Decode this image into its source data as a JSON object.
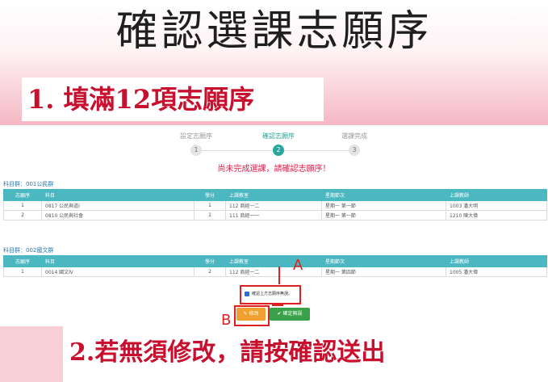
{
  "main_title": "確認選課志願序",
  "step1_text": "1. 填滿12項志願序",
  "step2_text": "2.若無須修改，請按確認送出",
  "wizard": {
    "steps": [
      {
        "label": "設定志願序",
        "num": "1"
      },
      {
        "label": "確認志願序",
        "num": "2"
      },
      {
        "label": "選課完成",
        "num": "3"
      }
    ]
  },
  "warning": "尚未完成選課，請確認志願序！",
  "sections": [
    {
      "title": "科目群：001公民群",
      "headers": [
        "志願序",
        "科目",
        "學分",
        "上課教室",
        "星期節次",
        "上課教師"
      ],
      "rows": [
        [
          "1",
          "0817 公民與道Ⅰ",
          "1",
          "112 商經一二",
          "星期一 第一節",
          "1003 潘大明"
        ],
        [
          "2",
          "0810 公民與社會",
          "1",
          "111 商經一一",
          "星期一 第一節",
          "1210 陳大偉"
        ]
      ]
    },
    {
      "title": "科目群：002國文群",
      "headers": [
        "志願序",
        "科目",
        "學分",
        "上課教室",
        "星期節次",
        "上課教師"
      ],
      "rows": [
        [
          "1",
          "0014 國文Ⅳ",
          "2",
          "112 商經一二",
          "星期一 第四節",
          "1005 潘大偉"
        ]
      ]
    }
  ],
  "confirm_label": "確認上方志願序無誤。",
  "marker_a": "A",
  "marker_b": "B",
  "buttons": {
    "edit": "✎ 修改",
    "confirm": "✔ 確定無誤"
  },
  "colors": {
    "accent": "#2aa59b",
    "table_header": "#4bb7c0",
    "warning": "#d9234b",
    "annotation": "#e02020",
    "edit_button": "#f0a030",
    "confirm_button": "#3aa04a"
  }
}
